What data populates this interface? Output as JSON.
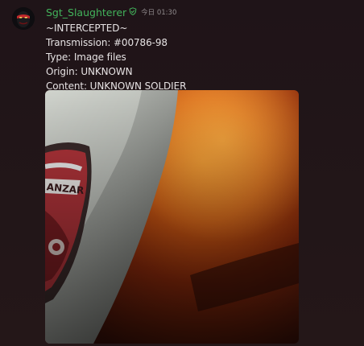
{
  "message": {
    "author": "Sgt_Slaughterer",
    "role_icon": "shield-icon",
    "timestamp": "今日 01:30",
    "content_lines": [
      "~INTERCEPTED~",
      "Transmission: #00786-98",
      "Type: Image files",
      "Origin: UNKNOWN",
      "Content: UNKNOWN SOLDIER"
    ],
    "attachment": {
      "kind": "image",
      "description_icon": "image-attachment-icon"
    }
  },
  "colors": {
    "background": "#221617",
    "username": "#42b35b",
    "text": "#e6e2e3",
    "timestamp": "#8f8a8c"
  }
}
